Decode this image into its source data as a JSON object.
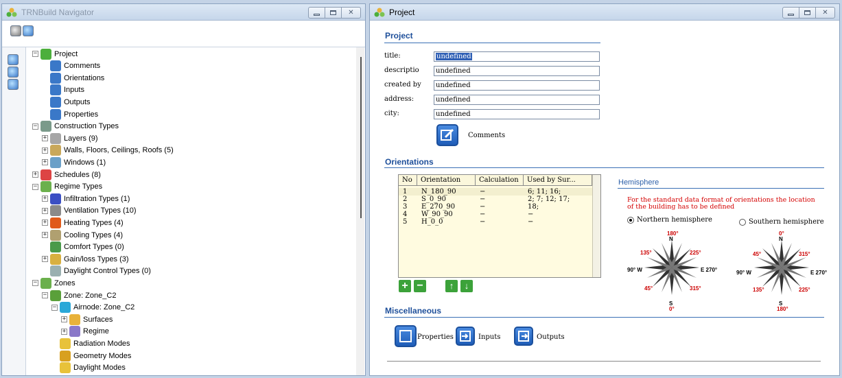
{
  "navigator": {
    "title": "TRNBuild Navigator",
    "tree": [
      {
        "label": "Project",
        "depth": 0,
        "exp": "−"
      },
      {
        "label": "Comments",
        "depth": 1,
        "exp": ""
      },
      {
        "label": "Orientations",
        "depth": 1,
        "exp": ""
      },
      {
        "label": "Inputs",
        "depth": 1,
        "exp": ""
      },
      {
        "label": "Outputs",
        "depth": 1,
        "exp": ""
      },
      {
        "label": "Properties",
        "depth": 1,
        "exp": ""
      },
      {
        "label": "Construction Types",
        "depth": 0,
        "exp": "−"
      },
      {
        "label": "Layers (9)",
        "depth": 1,
        "exp": "+"
      },
      {
        "label": "Walls, Floors, Ceilings, Roofs (5)",
        "depth": 1,
        "exp": "+"
      },
      {
        "label": "Windows (1)",
        "depth": 1,
        "exp": "+"
      },
      {
        "label": "Schedules (8)",
        "depth": 0,
        "exp": "+"
      },
      {
        "label": "Regime Types",
        "depth": 0,
        "exp": "−"
      },
      {
        "label": "Infiltration Types (1)",
        "depth": 1,
        "exp": "+"
      },
      {
        "label": "Ventilation Types (10)",
        "depth": 1,
        "exp": "+"
      },
      {
        "label": "Heating Types (4)",
        "depth": 1,
        "exp": "+"
      },
      {
        "label": "Cooling Types (4)",
        "depth": 1,
        "exp": "+"
      },
      {
        "label": "Comfort Types (0)",
        "depth": 1,
        "exp": ""
      },
      {
        "label": "Gain/loss Types (3)",
        "depth": 1,
        "exp": "+"
      },
      {
        "label": "Daylight Control Types (0)",
        "depth": 1,
        "exp": ""
      },
      {
        "label": "Zones",
        "depth": 0,
        "exp": "−"
      },
      {
        "label": "Zone: Zone_C2",
        "depth": 1,
        "exp": "−"
      },
      {
        "label": "Airnode: Zone_C2",
        "depth": 2,
        "exp": "−"
      },
      {
        "label": "Surfaces",
        "depth": 3,
        "exp": "+"
      },
      {
        "label": "Regime",
        "depth": 3,
        "exp": "+"
      },
      {
        "label": "Radiation Modes",
        "depth": 2,
        "exp": ""
      },
      {
        "label": "Geometry Modes",
        "depth": 2,
        "exp": ""
      },
      {
        "label": "Daylight Modes",
        "depth": 2,
        "exp": ""
      }
    ]
  },
  "project": {
    "title": "Project",
    "section_project": "Project",
    "fields": [
      {
        "label": "title:",
        "value": "undefined",
        "selected": true
      },
      {
        "label": "descriptio",
        "value": "undefined"
      },
      {
        "label": "created by",
        "value": "undefined"
      },
      {
        "label": "address:",
        "value": "undefined"
      },
      {
        "label": "city:",
        "value": "undefined"
      }
    ],
    "comments_label": "Comments",
    "section_orientations": "Orientations",
    "orient_headers": [
      "No",
      "Orientation",
      "Calculation",
      "Used by Sur..."
    ],
    "orient_rows": [
      [
        "1",
        "N_180_90",
        "−",
        "6; 11; 16;"
      ],
      [
        "2",
        "S_0_90",
        "−",
        "2; 7; 12; 17;"
      ],
      [
        "3",
        "E_270_90",
        "−",
        "18;"
      ],
      [
        "4",
        "W_90_90",
        "−",
        "−"
      ],
      [
        "5",
        "H_0_0",
        "−",
        "−"
      ]
    ],
    "hemisphere_title": "Hemisphere",
    "hemisphere_note_1": "For the standard data format of orientations the location",
    "hemisphere_note_2": "of the building has to be defined",
    "northern_label": "Northern hemisphere",
    "southern_label": "Southern hemisphere",
    "north_compass": {
      "top": "180°",
      "top_letter": "N",
      "tl": "135°",
      "tr": "225°",
      "left": "90° W",
      "right": "E 270°",
      "bl": "45°",
      "br": "315°",
      "bottom_letter": "S",
      "bottom": "0°"
    },
    "south_compass": {
      "top": "0°",
      "top_letter": "N",
      "tl": "45°",
      "tr": "315°",
      "left": "90° W",
      "right": "E 270°",
      "bl": "135°",
      "br": "225°",
      "bottom_letter": "S",
      "bottom": "180°"
    },
    "section_misc": "Miscellaneous",
    "properties_label": "Properties",
    "inputs_label": "Inputs",
    "outputs_label": "Outputs"
  }
}
